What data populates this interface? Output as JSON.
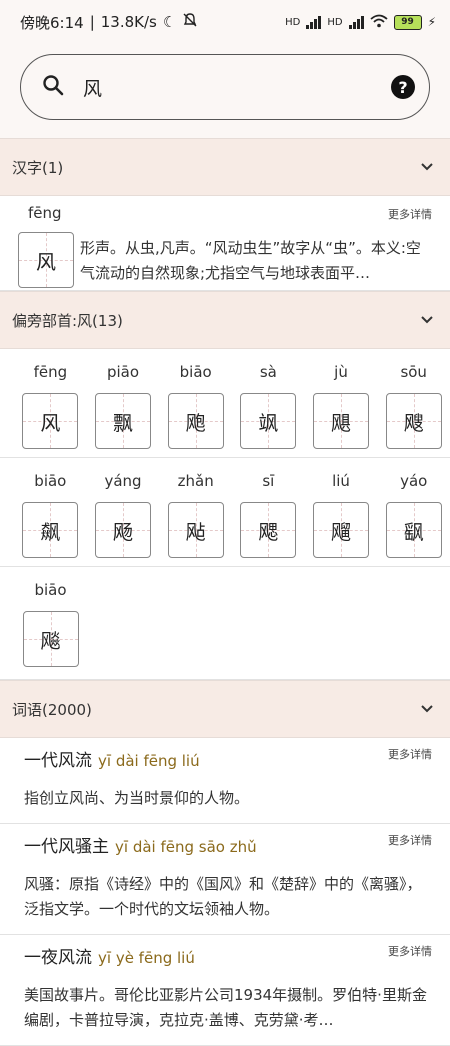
{
  "status": {
    "time": "傍晚6:14",
    "speed": "13.8K/s",
    "hd1": "HD",
    "hd2": "HD",
    "battery": "99"
  },
  "search": {
    "query": "风",
    "help": "?"
  },
  "hanzi_section": {
    "title": "汉字(1)",
    "item": {
      "pinyin": "fēng",
      "char": "风",
      "more": "更多详情",
      "definition": "形声。从虫,凡声。“风动虫生”故字从“虫”。本义:空气流动的自然现象;尤指空气与地球表面平…"
    }
  },
  "radical_section": {
    "title": "偏旁部首:风(13)",
    "rows": [
      [
        {
          "pinyin": "fēng",
          "char": "风"
        },
        {
          "pinyin": "piāo",
          "char": "飘"
        },
        {
          "pinyin": "biāo",
          "char": "飑"
        },
        {
          "pinyin": "sà",
          "char": "飒"
        },
        {
          "pinyin": "jù",
          "char": "飓"
        },
        {
          "pinyin": "sōu",
          "char": "飕"
        }
      ],
      [
        {
          "pinyin": "biāo",
          "char": "飙"
        },
        {
          "pinyin": "yáng",
          "char": "飏"
        },
        {
          "pinyin": "zhǎn",
          "char": "飐"
        },
        {
          "pinyin": "sī",
          "char": "飔"
        },
        {
          "pinyin": "liú",
          "char": "飗"
        },
        {
          "pinyin": "yáo",
          "char": "飖"
        }
      ],
      [
        {
          "pinyin": "biāo",
          "char": "飚"
        }
      ]
    ]
  },
  "words_section": {
    "title": "词语(2000)",
    "items": [
      {
        "word": "一代风流",
        "pinyin": "yī dài fēng liú",
        "more": "更多详情",
        "definition": "指创立风尚、为当时景仰的人物。"
      },
      {
        "word": "一代风骚主",
        "pinyin": "yī dài fēng sāo zhǔ",
        "more": "更多详情",
        "definition": "风骚：原指《诗经》中的《国风》和《楚辞》中的《离骚》，泛指文学。一个时代的文坛领袖人物。"
      },
      {
        "word": "一夜风流",
        "pinyin": "yī yè fēng liú",
        "more": "更多详情",
        "definition": "美国故事片。哥伦比亚影片公司1934年摄制。罗伯特·里斯金编剧，卡普拉导演，克拉克·盖博、克劳黛·考…"
      }
    ]
  }
}
